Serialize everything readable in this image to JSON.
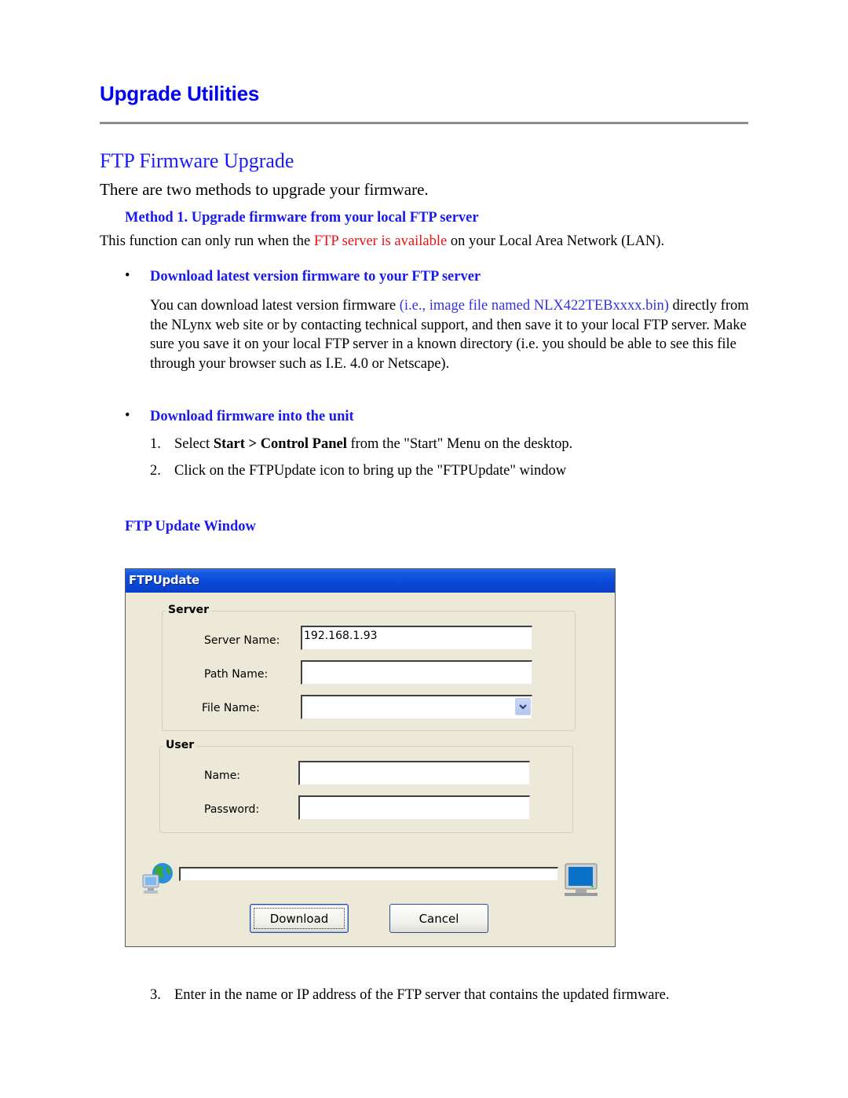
{
  "document": {
    "section_title": "Upgrade Utilities",
    "subsection_title": "FTP Firmware Upgrade",
    "intro": "There are two methods to upgrade your firmware.",
    "method1_heading": "Method 1.  Upgrade firmware from your local FTP server",
    "method1_para": {
      "before": "This function can only run when the ",
      "highlight": "FTP server is available",
      "after": " on your Local Area Network (LAN)."
    },
    "bullets": [
      {
        "title": "Download latest version firmware to your FTP server",
        "para_before": "You can download latest version firmware ",
        "para_highlight": "(i.e., image file named NLX422TEBxxxx.bin)",
        "para_after": " directly from the NLynx web site or by contacting technical support, and then save it to your local FTP server.  Make sure you save it on your local FTP server in a known directory (i.e. you should be able to see this file through your browser such as I.E. 4.0 or Netscape)."
      },
      {
        "title": "Download firmware into the unit"
      }
    ],
    "steps": [
      {
        "num": "1.",
        "before": "Select ",
        "bold": "Start > Control Panel",
        "after": " from the \"Start\" Menu on the desktop."
      },
      {
        "num": "2.",
        "text": "Click on the FTPUpdate icon to bring up the \"FTPUpdate\" window"
      },
      {
        "num": "3.",
        "text": "Enter in the name or IP address of the FTP server that contains the updated firmware."
      }
    ],
    "figure_caption": "FTP Update Window",
    "bullet_glyph": "•"
  },
  "ftp_window": {
    "title": "FTPUpdate",
    "server_group": {
      "label": "Server",
      "server_name_label": "Server Name:",
      "server_name_value": "192.168.1.93",
      "path_name_label": "Path Name:",
      "path_name_value": "",
      "file_name_label": "File Name:",
      "file_name_value": ""
    },
    "user_group": {
      "label": "User",
      "name_label": "Name:",
      "name_value": "",
      "password_label": "Password:",
      "password_value": ""
    },
    "progress_percent": 0,
    "download_button": "Download",
    "cancel_button": "Cancel",
    "icons": {
      "left": "network-globe-icon",
      "right": "computer-monitor-icon",
      "dropdown": "chevron-down-icon"
    }
  },
  "colors": {
    "heading_blue": "#0000ee",
    "highlight_red": "#ee1111",
    "titlebar_blue": "#0a48d8",
    "dialog_bg": "#ece9d8"
  }
}
